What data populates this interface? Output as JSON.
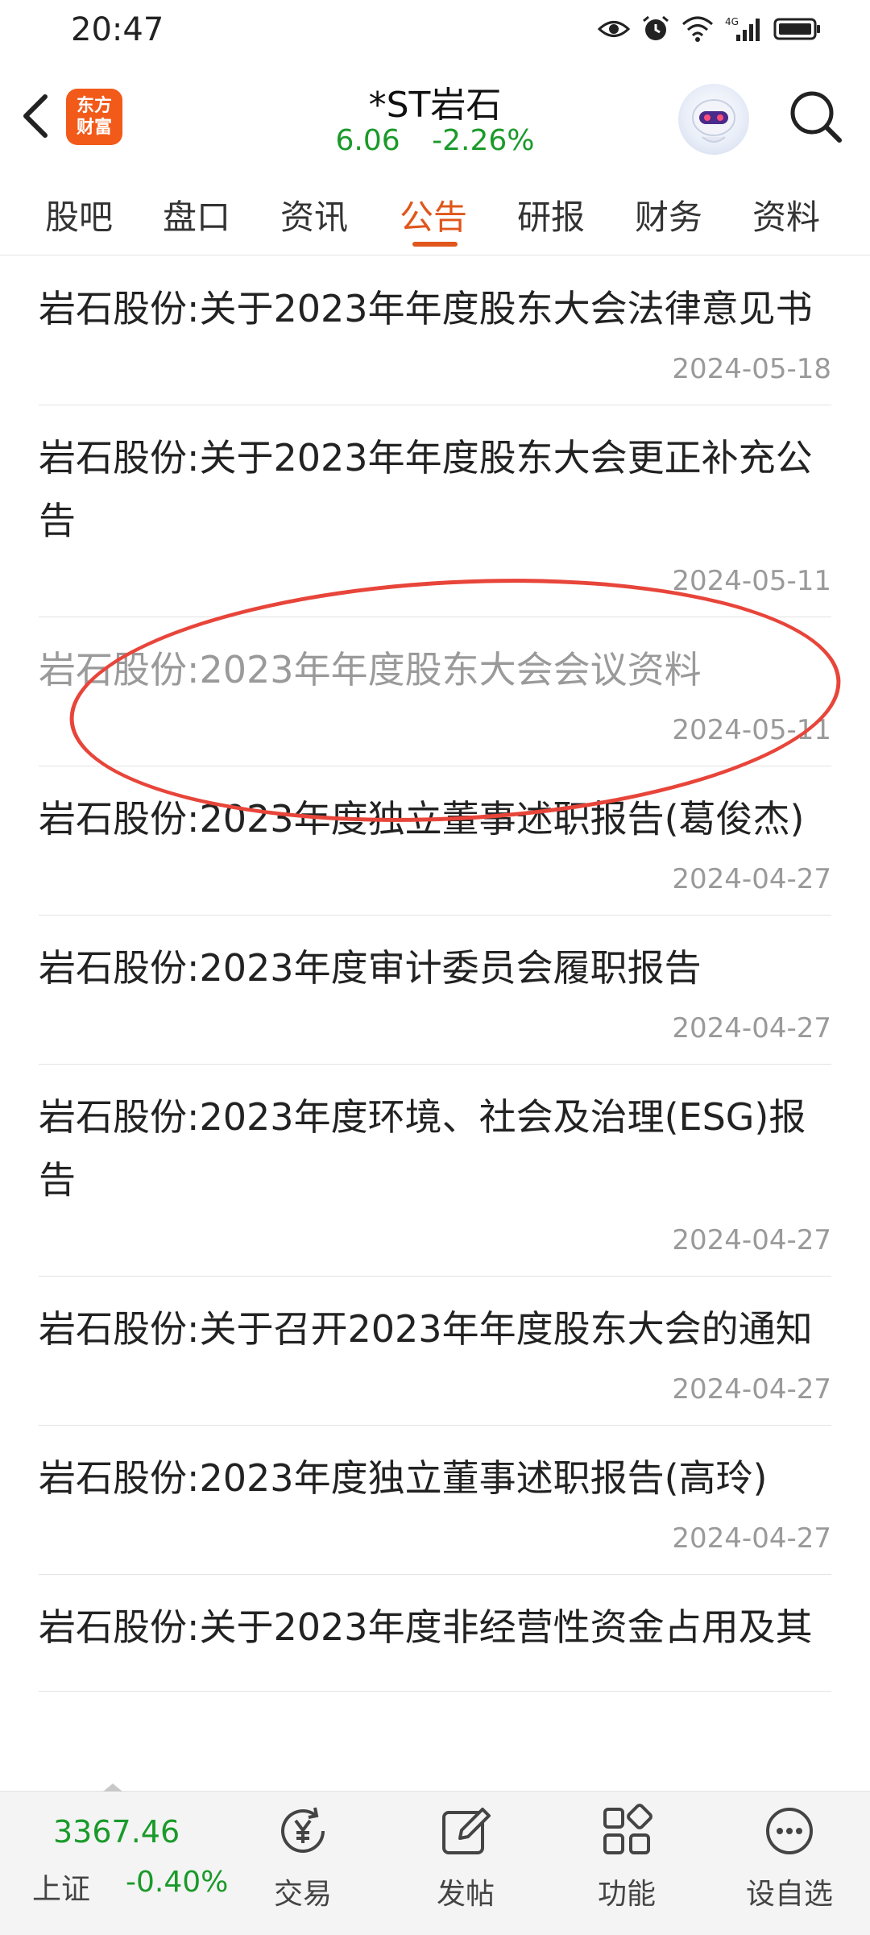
{
  "status_bar": {
    "time": "20:47",
    "icons": [
      "eye-icon",
      "alarm-icon",
      "wifi-icon",
      "signal-4g-icon",
      "battery-icon"
    ],
    "network": "4G"
  },
  "header": {
    "title": "*ST岩石",
    "price": "6.06",
    "change": "-2.26%",
    "logo_line1": "东方",
    "logo_line2": "财富",
    "price_color": "#1a9a2a",
    "accent": "#e0561b"
  },
  "tabs": [
    {
      "label": "股吧"
    },
    {
      "label": "盘口"
    },
    {
      "label": "资讯"
    },
    {
      "label": "公告",
      "active": true
    },
    {
      "label": "研报"
    },
    {
      "label": "财务"
    },
    {
      "label": "资料"
    }
  ],
  "announcements": [
    {
      "title": "岩石股份:关于2023年年度股东大会法律意见书",
      "date": "2024-05-18"
    },
    {
      "title": "岩石股份:关于2023年年度股东大会更正补充公告",
      "date": "2024-05-11"
    },
    {
      "title": "岩石股份:2023年年度股东大会会议资料",
      "date": "2024-05-11",
      "viewed": true
    },
    {
      "title": "岩石股份:2023年度独立董事述职报告(葛俊杰)",
      "date": "2024-04-27"
    },
    {
      "title": "岩石股份:2023年度审计委员会履职报告",
      "date": "2024-04-27"
    },
    {
      "title": "岩石股份:2023年度环境、社会及治理(ESG)报告",
      "date": "2024-04-27"
    },
    {
      "title": "岩石股份:关于召开2023年年度股东大会的通知",
      "date": "2024-04-27"
    },
    {
      "title": "岩石股份:2023年度独立董事述职报告(高玲)",
      "date": "2024-04-27"
    },
    {
      "title": "岩石股份:关于2023年度非经营性资金占用及其",
      "date": ""
    }
  ],
  "bottom_bar": {
    "index_value": "3367.46",
    "index_name": "上证",
    "index_change": "-0.40%",
    "items": [
      {
        "label": "交易",
        "icon": "trade-yen-icon"
      },
      {
        "label": "发帖",
        "icon": "compose-icon"
      },
      {
        "label": "功能",
        "icon": "grid-icon"
      },
      {
        "label": "设自选",
        "icon": "more-icon"
      }
    ]
  },
  "annotation_color": "#e8453a"
}
